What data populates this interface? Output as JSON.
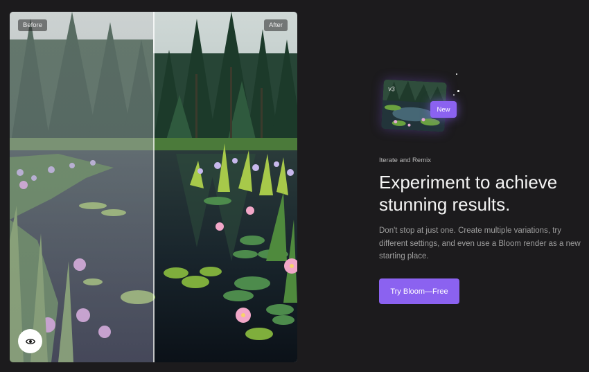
{
  "compare": {
    "before_label": "Before",
    "after_label": "After"
  },
  "icons": {
    "toggle_view": "eye-icon"
  },
  "feature": {
    "thumbnail_version": "v3",
    "new_badge": "New",
    "eyebrow": "Iterate and Remix",
    "headline_line1": "Experiment to achieve",
    "headline_line2": "stunning results.",
    "body": "Don't stop at just one. Create multiple variations, try different settings, and even use a Bloom render as a new starting place.",
    "cta_label": "Try Bloom—Free"
  },
  "colors": {
    "background": "#1c1b1d",
    "accent": "#8b62f0",
    "headline": "#f4f4f4",
    "body_text": "#9e9e9e"
  }
}
